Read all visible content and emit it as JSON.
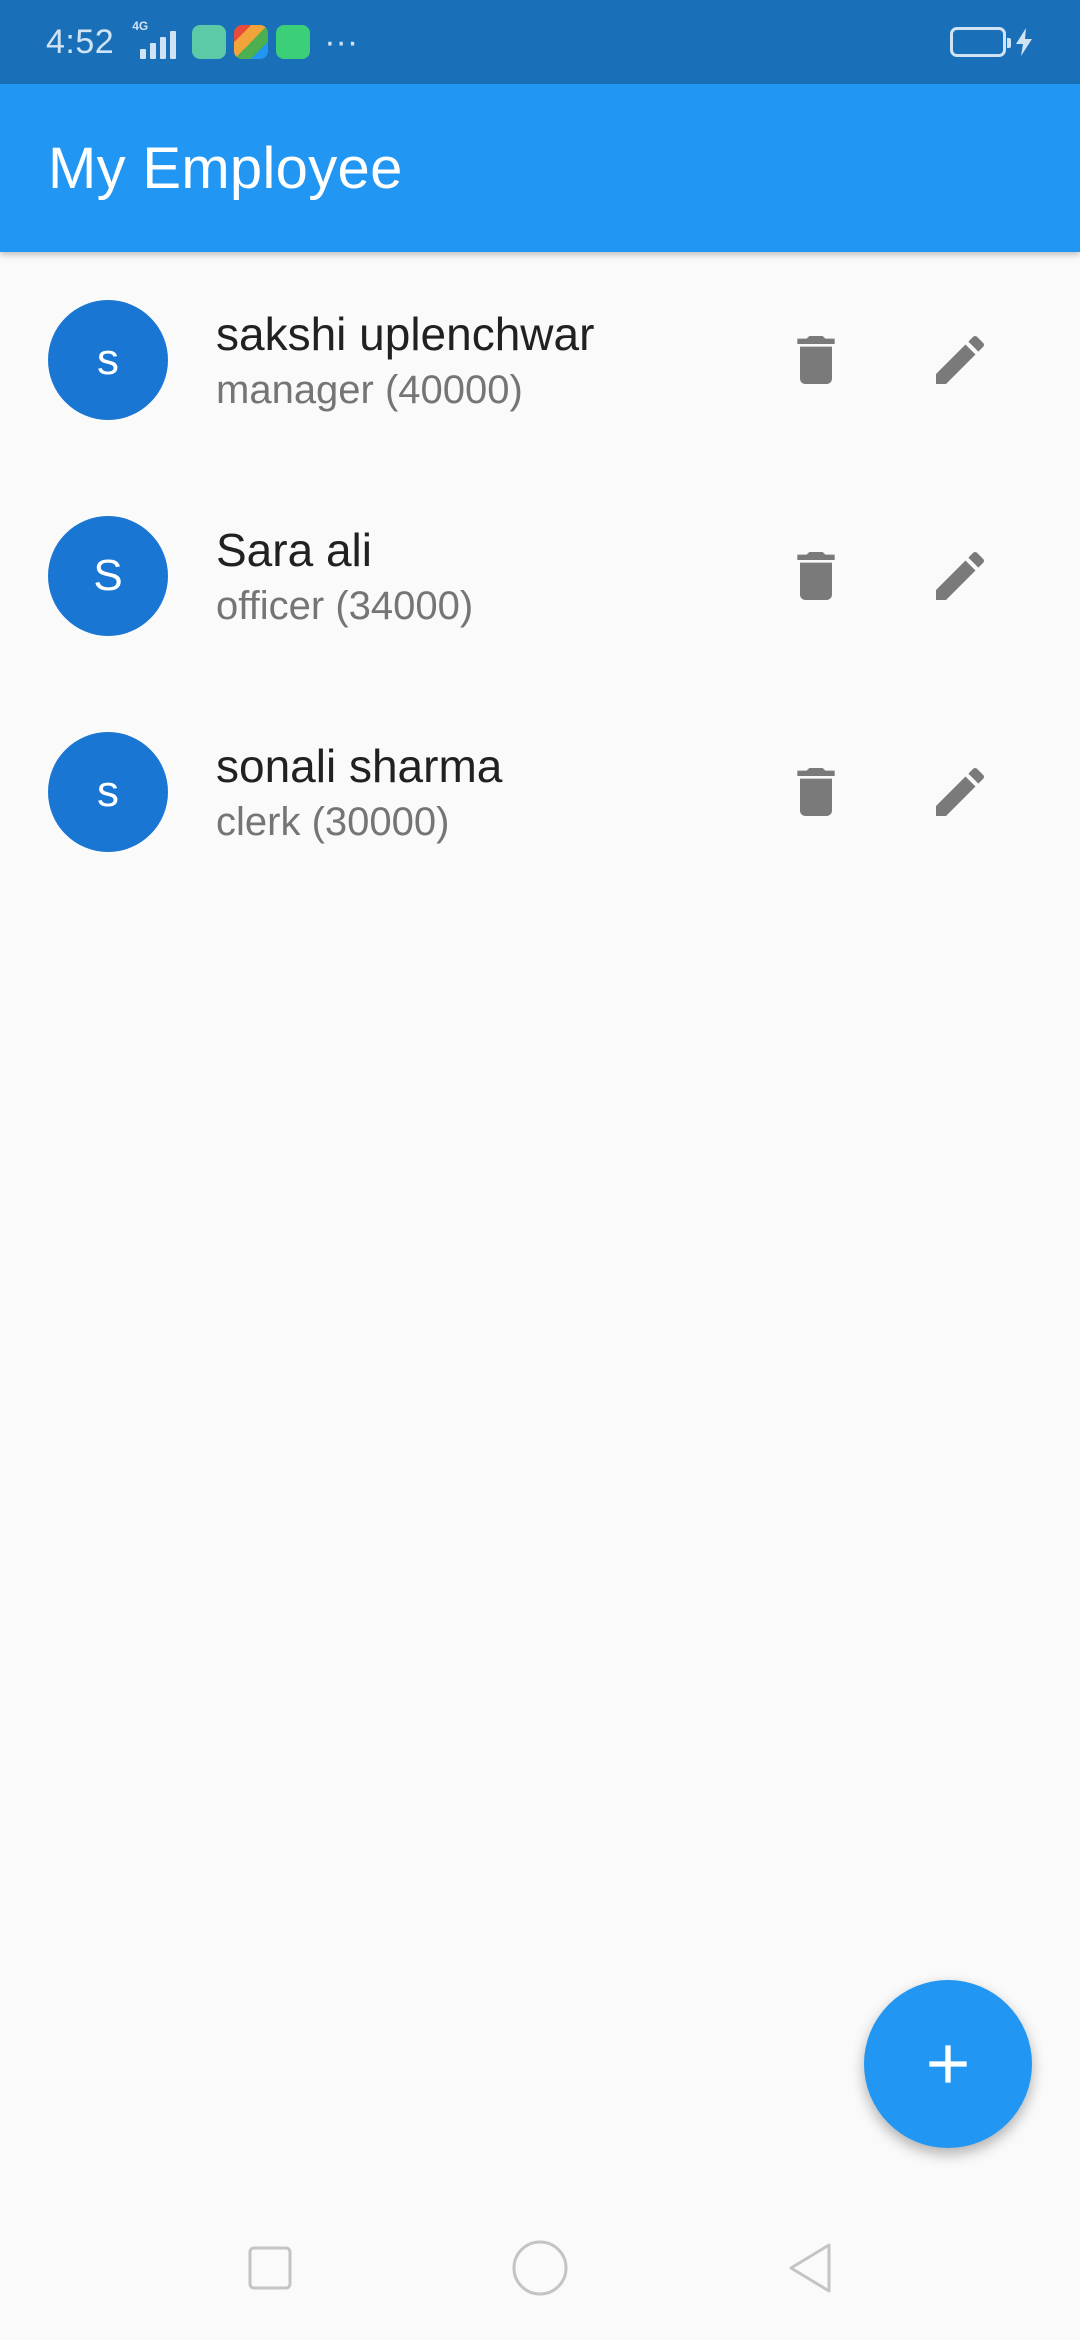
{
  "status_bar": {
    "time": "4:52",
    "network": "4G",
    "more": "···",
    "colors": {
      "background": "#1a70b8",
      "foreground": "#cfe3f5"
    },
    "apps": [
      {
        "icon": "calculator-app-icon",
        "color": "#5cc9a7"
      },
      {
        "icon": "pinwheel-app-icon",
        "color": "#f2a33a"
      },
      {
        "icon": "sync-app-icon",
        "color": "#3ccf7a"
      }
    ]
  },
  "app_bar": {
    "title": "My Employee",
    "color": "#2196f3"
  },
  "employees": [
    {
      "initial": "s",
      "name": "sakshi uplenchwar",
      "subtitle": "manager (40000)"
    },
    {
      "initial": "S",
      "name": "Sara ali",
      "subtitle": "officer (34000)"
    },
    {
      "initial": "s",
      "name": "sonali sharma",
      "subtitle": "clerk (30000)"
    }
  ],
  "icons": {
    "delete": "delete-icon",
    "edit": "edit-icon",
    "add": "add-icon"
  },
  "colors": {
    "accent": "#2196f3",
    "avatar": "#1976d2",
    "icon_gray": "#7a7a7a"
  },
  "nav_bar": {
    "recent": "recent-apps-icon",
    "home": "home-icon",
    "back": "back-icon"
  }
}
